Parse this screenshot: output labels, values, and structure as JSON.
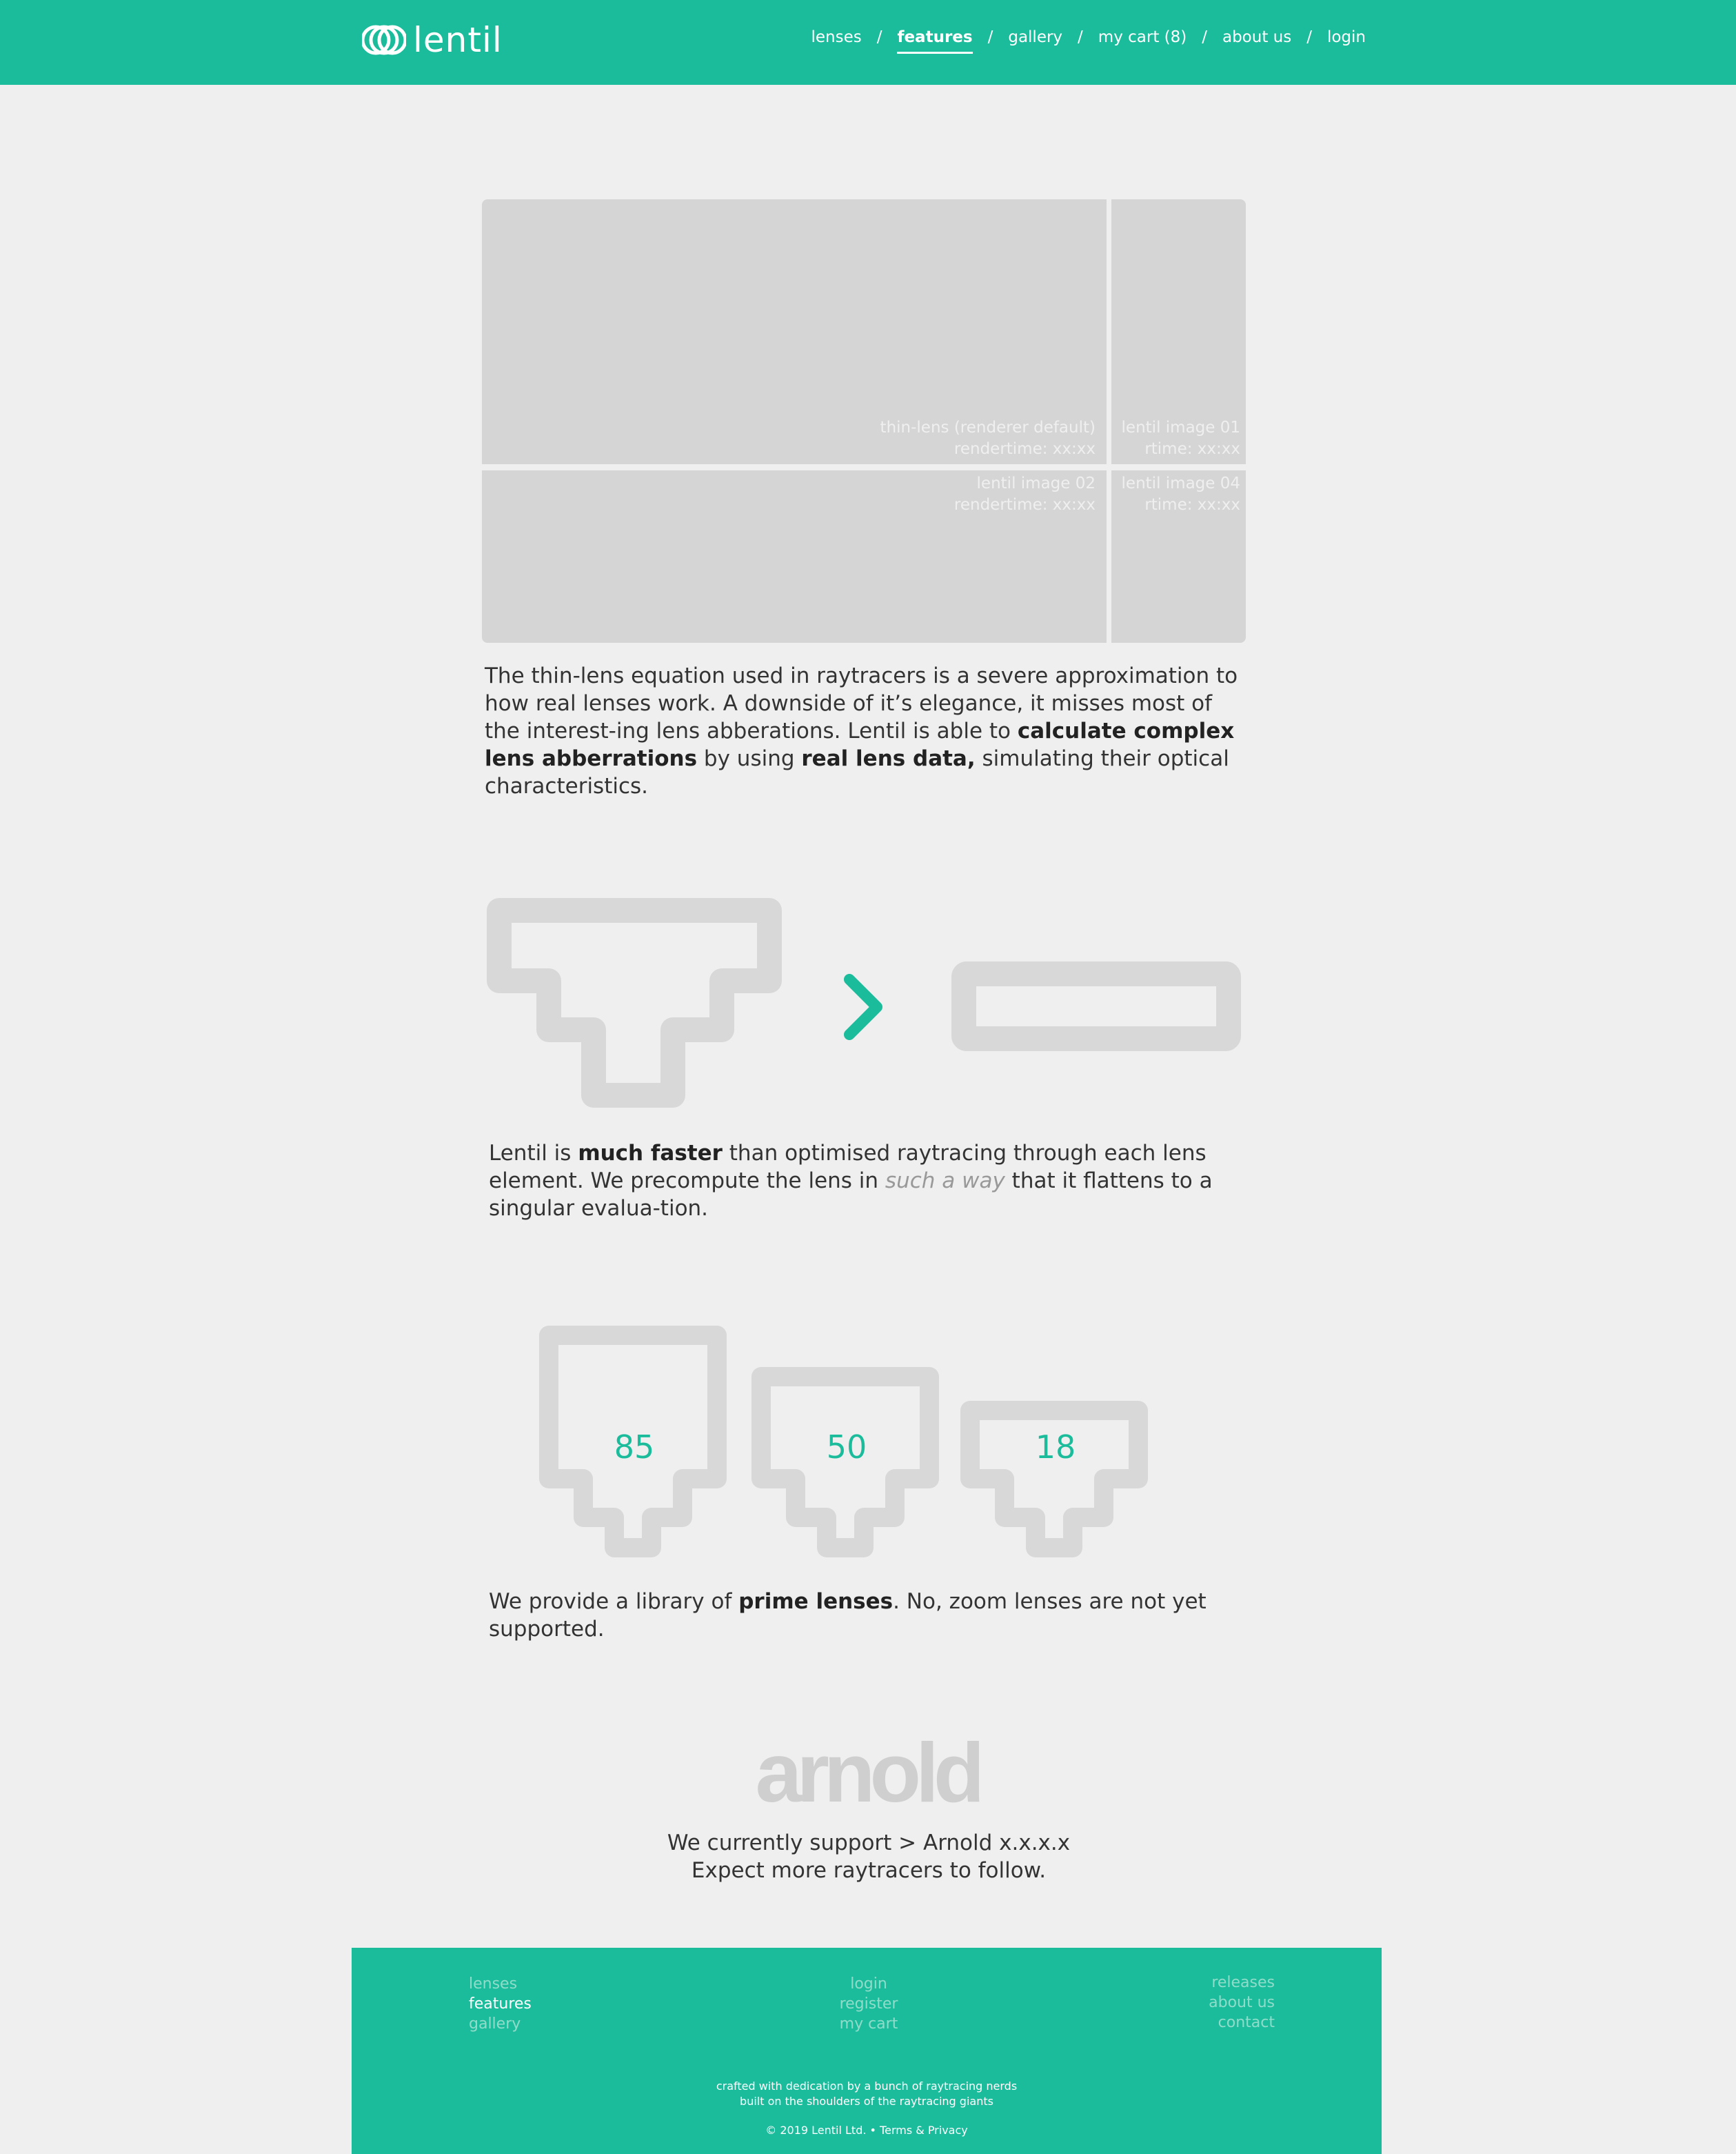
{
  "header": {
    "brand": "lentil",
    "nav": [
      {
        "label": "lenses"
      },
      {
        "label": "features",
        "active": true
      },
      {
        "label": "gallery"
      },
      {
        "label": "my cart (8)"
      },
      {
        "label": "about us"
      },
      {
        "label": "login"
      }
    ],
    "separator": "/"
  },
  "gallery": {
    "tiles": [
      {
        "title": "thin-lens (renderer default)",
        "time": "rendertime: xx:xx"
      },
      {
        "title": "lentil image 01",
        "time": "rtime: xx:xx"
      },
      {
        "title": "lentil image 02",
        "time": "rendertime: xx:xx"
      },
      {
        "title": "lentil image 04",
        "time": "rtime: xx:xx"
      }
    ]
  },
  "intro": {
    "text1": "The thin-lens equation used in raytracers is a severe approximation to how real lenses work. A downside of it’s elegance, it misses most of the interest-ing lens abberations. Lentil is able to ",
    "bold1": "calculate complex lens abberrations",
    "text2": " by using ",
    "bold2": "real lens data,",
    "text3": " simulating their optical characteristics."
  },
  "speed": {
    "text1": "Lentil is ",
    "bold1": "much faster",
    "text2": " than optimised raytracing through each lens element. We precompute the lens in ",
    "italic1": "such a way",
    "text3": " that it flattens to a singular evalua-tion.",
    "arrow_icon": "chevron-right-icon"
  },
  "primes": {
    "focal_lengths": [
      "85",
      "50",
      "18"
    ],
    "text1": "We provide a library of ",
    "bold1": "prime lenses",
    "text2": ". No, zoom lenses are not yet supported."
  },
  "arnold": {
    "logo_text": "arnold",
    "line1": "We currently support > Arnold x.x.x.x",
    "line2": "Expect more raytracers to follow."
  },
  "footer": {
    "col1": [
      "lenses",
      "features",
      "gallery"
    ],
    "col2": [
      "login",
      "register",
      "my cart"
    ],
    "col3": [
      "releases",
      "about us",
      "contact"
    ],
    "tagline1": "crafted with dedication by a bunch of raytracing nerds",
    "tagline2": "built on the shoulders of the raytracing giants",
    "copyright": "© 2019 Lentil Ltd. • Terms & Privacy"
  },
  "colors": {
    "brand": "#1bbc9b",
    "placeholder": "#d5d5d5",
    "background": "#efefef"
  }
}
